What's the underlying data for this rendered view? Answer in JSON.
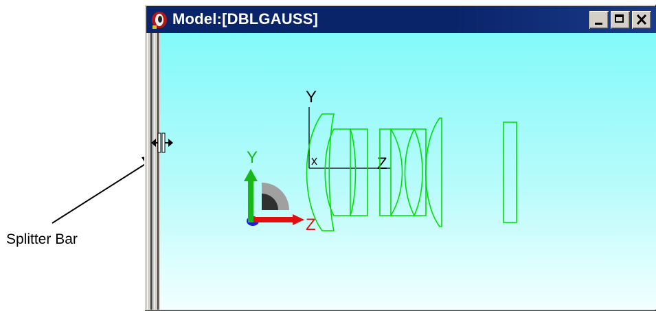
{
  "window": {
    "title": "Model:[DBLGAUSS]",
    "controls": [
      "minimize",
      "maximize",
      "close"
    ]
  },
  "viewport": {
    "background_top": "#82fafa",
    "background_bottom": "#f2ffff",
    "lens_color": "#00e000",
    "lens_axes": {
      "y_label": "Y",
      "x_label": "X",
      "z_label": "Z"
    },
    "triad": {
      "y_label": "Y",
      "z_label": "Z",
      "y_color": "#18b818",
      "z_color": "#e01010",
      "x_color": "#2020d0"
    }
  },
  "callout": {
    "label": "Splitter Bar"
  },
  "icons": {
    "app": "lens-app-icon",
    "cursor": "splitter-resize-cursor-icon"
  }
}
